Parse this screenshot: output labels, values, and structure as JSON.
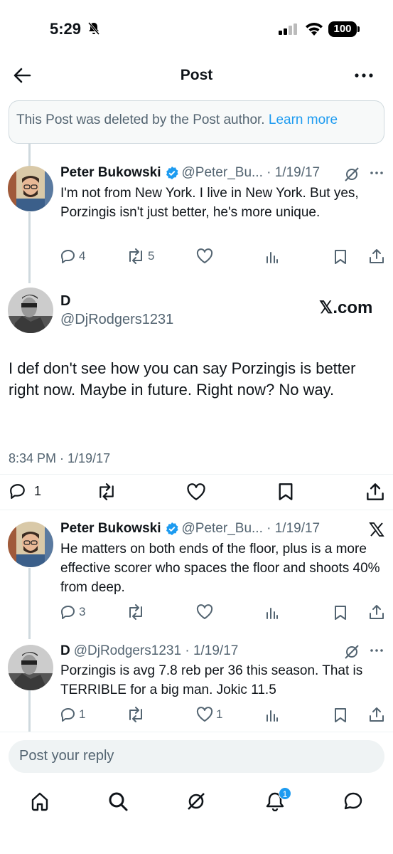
{
  "status_bar": {
    "time": "5:29",
    "battery": "100"
  },
  "header": {
    "title": "Post"
  },
  "deleted_notice": {
    "text": "This Post was deleted by the Post author.",
    "link": "Learn more"
  },
  "replies": [
    {
      "name": "Peter Bukowski",
      "handle": "@Peter_Bu...",
      "date": "1/19/17",
      "text": "I'm not from New York. I live in New York. But yes, Porzingis isn't just better, he's more unique.",
      "replies": "4",
      "reposts": "5",
      "likes": ""
    }
  ],
  "main_post": {
    "name": "D",
    "handle": "@DjRodgers1231",
    "watermark": "𝕏.com",
    "text": "I def don't see how you can say Porzingis is better right now.  Maybe in future.  Right now? No way.",
    "timestamp": "8:34 PM · 1/19/17",
    "replies": "1"
  },
  "thread_replies": [
    {
      "name": "Peter Bukowski",
      "handle": "@Peter_Bu...",
      "date": "1/19/17",
      "text": "He matters on both ends of the floor, plus is a more effective scorer who spaces the floor and shoots 40% from deep.",
      "replies": "3",
      "reposts": "",
      "likes": ""
    },
    {
      "name": "D",
      "handle": "@DjRodgers1231",
      "date": "1/19/17",
      "text": "Porzingis is avg 7.8 reb per 36 this season. That is TERRIBLE for a big man.  Jokic 11.5",
      "replies": "1",
      "reposts": "",
      "likes": "1"
    }
  ],
  "reply_box": {
    "placeholder": "Post your reply"
  },
  "tab_bar": {
    "notifications_badge": "1"
  },
  "colors": {
    "accent": "#1d9bf0",
    "muted": "#536471"
  }
}
